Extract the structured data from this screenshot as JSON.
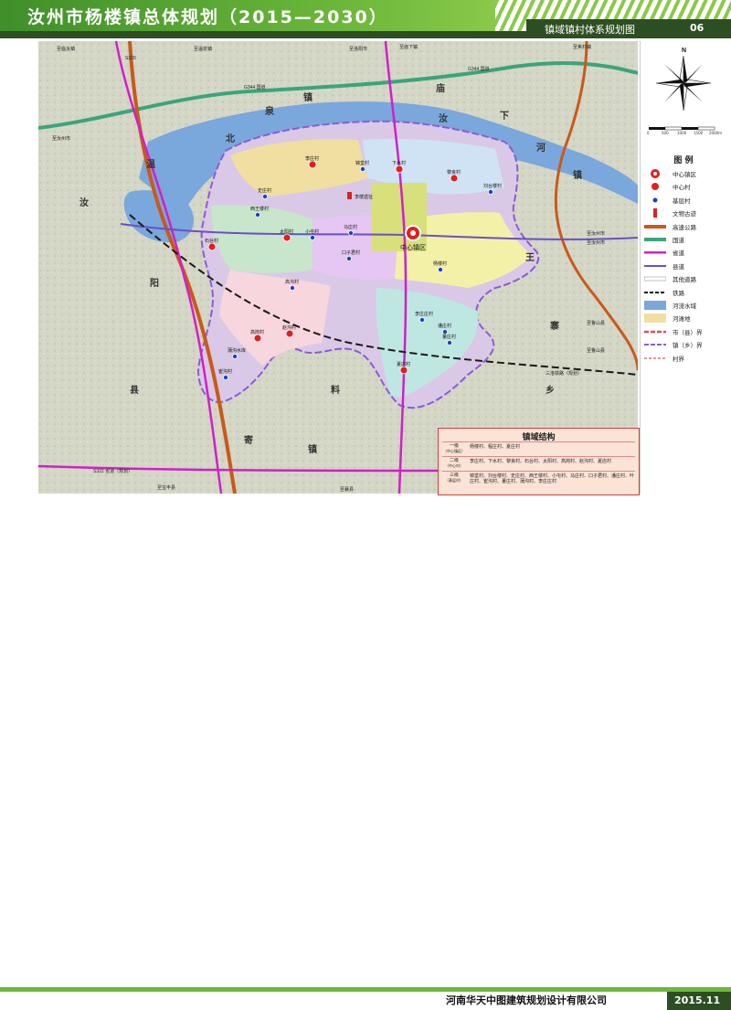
{
  "header": {
    "title": "汝州市杨楼镇总体规划（2015—2030）",
    "subtitle": "镇域镇村体系规划图",
    "page_number": "06"
  },
  "footer": {
    "company": "河南华天中图建筑规划设计有限公司",
    "date": "2015.11"
  },
  "map": {
    "place_labels": [
      {
        "text": "北"
      },
      {
        "text": "泉"
      },
      {
        "text": "汝"
      },
      {
        "text": "温"
      },
      {
        "text": "阳"
      },
      {
        "text": "县"
      },
      {
        "text": "庙"
      },
      {
        "text": "镇"
      },
      {
        "text": "下"
      },
      {
        "text": "河"
      },
      {
        "text": "王"
      },
      {
        "text": "寨"
      },
      {
        "text": "乡"
      },
      {
        "text": "镇"
      },
      {
        "text": "料"
      },
      {
        "text": "寄"
      },
      {
        "text": "汝"
      },
      {
        "text": "镇"
      }
    ],
    "road_labels": [
      {
        "text": "G344 国道"
      },
      {
        "text": "G344 国道"
      },
      {
        "text": "S320"
      },
      {
        "text": "S322 省道（规划）"
      },
      {
        "text": "三洛铁路（规划）"
      },
      {
        "text": "至汝州市"
      },
      {
        "text": "至汝州市"
      },
      {
        "text": "至汝州市"
      },
      {
        "text": "至鲁山县"
      },
      {
        "text": "至鲁山县"
      },
      {
        "text": "至宝丰县"
      },
      {
        "text": "至洛阳市"
      },
      {
        "text": "至临汝镇"
      },
      {
        "text": "至温泉镇"
      },
      {
        "text": "至庙下镇"
      },
      {
        "text": "至焦村镇"
      },
      {
        "text": "至襄县"
      }
    ],
    "villages": [
      {
        "name": "李庄村",
        "type": "center-village"
      },
      {
        "name": "锦堂村",
        "type": "base-village"
      },
      {
        "name": "下水村",
        "type": "center-village"
      },
      {
        "name": "黎良村",
        "type": "center-village"
      },
      {
        "name": "刘台楼村",
        "type": "base-village"
      },
      {
        "name": "史庄村",
        "type": "base-village"
      },
      {
        "name": "西王楼村",
        "type": "base-village"
      },
      {
        "name": "太阳村",
        "type": "center-village"
      },
      {
        "name": "小屯村",
        "type": "base-village"
      },
      {
        "name": "马庄村",
        "type": "base-village"
      },
      {
        "name": "口子君村",
        "type": "base-village"
      },
      {
        "name": "石台村",
        "type": "center-village"
      },
      {
        "name": "杨楼村",
        "type": "base-village"
      },
      {
        "name": "高沟村",
        "type": "base-village"
      },
      {
        "name": "赵沟村",
        "type": "center-village"
      },
      {
        "name": "高岗村",
        "type": "center-village"
      },
      {
        "name": "蒲沟水库",
        "type": "base-village"
      },
      {
        "name": "崔沟村",
        "type": "base-village"
      },
      {
        "name": "李庄庄村",
        "type": "base-village"
      },
      {
        "name": "潘庄村",
        "type": "base-village"
      },
      {
        "name": "董庄村",
        "type": "base-village"
      },
      {
        "name": "夏店村",
        "type": "center-village"
      }
    ],
    "town_center_label": "中心镇区",
    "relic_label": "李楼遗址"
  },
  "legend": {
    "title": "图  例",
    "items": [
      {
        "label": "中心镇区",
        "symbol": "town-center"
      },
      {
        "label": "中心村",
        "symbol": "center-village"
      },
      {
        "label": "基层村",
        "symbol": "base-village"
      },
      {
        "label": "文物古迹",
        "symbol": "relic"
      },
      {
        "label": "高速公路",
        "symbol": "expressway"
      },
      {
        "label": "国道",
        "symbol": "national-road"
      },
      {
        "label": "省道",
        "symbol": "provincial-road"
      },
      {
        "label": "县道",
        "symbol": "county-road"
      },
      {
        "label": "其他道路",
        "symbol": "other-road"
      },
      {
        "label": "铁路",
        "symbol": "railway"
      },
      {
        "label": "河流水域",
        "symbol": "water"
      },
      {
        "label": "河滩地",
        "symbol": "floodplain"
      },
      {
        "label": "市（县）界",
        "symbol": "city-boundary"
      },
      {
        "label": "镇（乡）界",
        "symbol": "town-boundary"
      },
      {
        "label": "村界",
        "symbol": "village-boundary"
      }
    ],
    "colors": {
      "town-center": "#e02020",
      "center-village": "#e02020",
      "base-village": "#1a3fd0",
      "expressway": "#c85a1a",
      "national-road": "#3aa57a",
      "provincial-road": "#d020c8",
      "county-road": "#6a4fc6",
      "water": "#7aa7dc",
      "floodplain": "#f0dfa0"
    }
  },
  "north_arrow": {
    "label": "N"
  },
  "scale_bar": {
    "ticks": [
      "0",
      "500",
      "1000",
      "1500",
      "2000m"
    ]
  },
  "structure_table": {
    "title": "镇域结构",
    "rows": [
      {
        "level": "一级",
        "sub": "（中心镇区）",
        "villages": "杨楼村、程庄村、夏庄村"
      },
      {
        "level": "二级",
        "sub": "（中心村）",
        "villages": "李庄村、下水村、黎良村、石台村、太阳村、高岗村、赵沟村、夏店村"
      },
      {
        "level": "三级",
        "sub": "（基层村）",
        "villages": "锦堂村、刘台楼村、史庄村、西王楼村、小屯村、马庄村、口子君村、潘庄村、叶庄村、崔沟村、董庄村、蒲沟村、李庄庄村"
      }
    ]
  }
}
